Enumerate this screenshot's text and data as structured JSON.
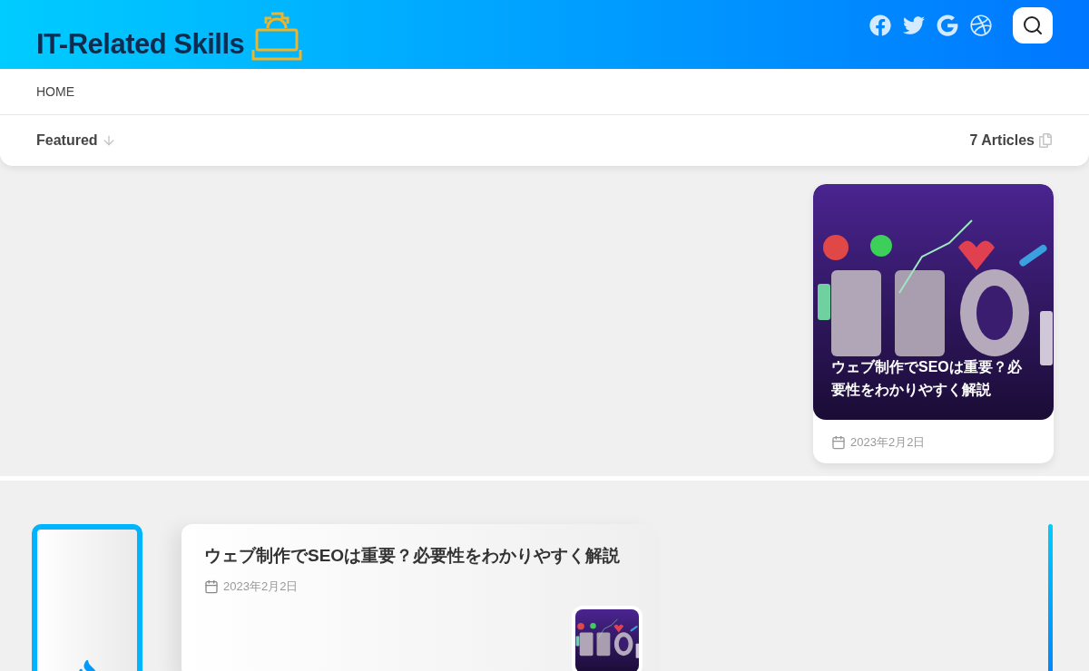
{
  "header": {
    "logo": "IT-Related Skills"
  },
  "nav": {
    "items": [
      {
        "label": "HOME"
      }
    ]
  },
  "featured_bar": {
    "label": "Featured",
    "count": "7 Articles"
  },
  "featured_card": {
    "title": "ウェブ制作でSEOは重要？必要性をわかりやすく解説",
    "date": "2023年2月2日"
  },
  "post": {
    "title": "ウェブ制作でSEOは重要？必要性をわかりやすく解説",
    "date": "2023年2月2日"
  }
}
